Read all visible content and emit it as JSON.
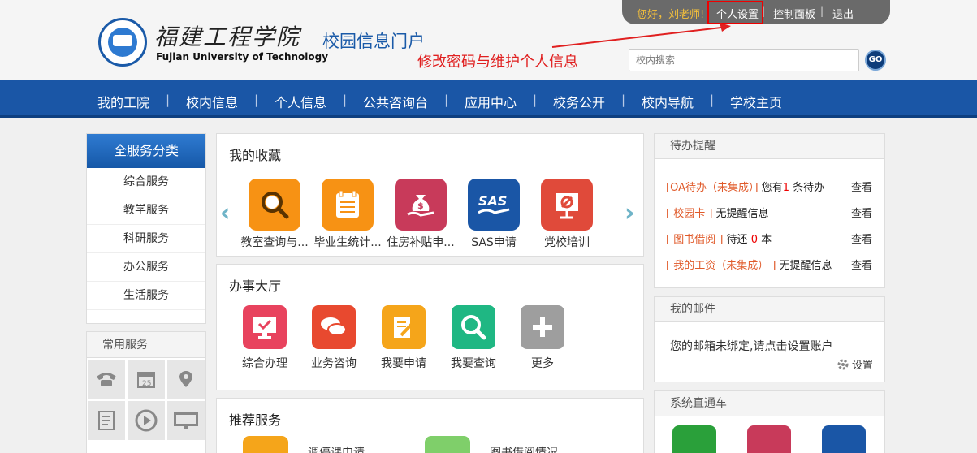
{
  "header": {
    "greeting": "您好，刘老师!",
    "links": [
      "个人设置",
      "控制面板",
      "退出"
    ],
    "separator": "|",
    "school_name_cn": "福建工程学院",
    "school_name_en": "Fujian University of Technology",
    "portal_title": "校园信息门户",
    "annotation": "修改密码与维护个人信息",
    "search_placeholder": "校内搜索",
    "go_label": "GO",
    "annotation_color": "#e02020"
  },
  "nav": {
    "items": [
      "我的工院",
      "校内信息",
      "个人信息",
      "公共咨询台",
      "应用中心",
      "校务公开",
      "校内导航",
      "学校主页"
    ],
    "separator": "|",
    "color": "#1a56a6"
  },
  "left": {
    "category_title": "全服务分类",
    "categories": [
      "综合服务",
      "教学服务",
      "科研服务",
      "办公服务",
      "生活服务"
    ],
    "common_title": "常用服务",
    "calendar_day": "25"
  },
  "favorites": {
    "title": "我的收藏",
    "items": [
      {
        "label": "教室查询与...",
        "icon": "search-icon",
        "color": "#f79214"
      },
      {
        "label": "毕业生统计...",
        "icon": "notepad-icon",
        "color": "#f79214"
      },
      {
        "label": "住房补贴申...",
        "icon": "money-bag-icon",
        "color": "#c83a5a"
      },
      {
        "label": "SAS申请",
        "icon": "sas-icon",
        "color": "#1a56a6"
      },
      {
        "label": "党校培训",
        "icon": "party-icon",
        "color": "#e04a3a"
      }
    ],
    "sas_text": "SAS",
    "money_symbol": "$"
  },
  "hall": {
    "title": "办事大厅",
    "items": [
      {
        "label": "综合办理",
        "icon": "monitor-check-icon",
        "color": "#e8435e"
      },
      {
        "label": "业务咨询",
        "icon": "chat-icon",
        "color": "#e8492f"
      },
      {
        "label": "我要申请",
        "icon": "edit-doc-icon",
        "color": "#f5a51a"
      },
      {
        "label": "我要查询",
        "icon": "search-icon",
        "color": "#1fb783"
      },
      {
        "label": "更多",
        "icon": "plus-icon",
        "color": "#9e9e9e"
      }
    ]
  },
  "recommend": {
    "title": "推荐服务",
    "items": [
      "调停课申请",
      "图书借阅情况"
    ]
  },
  "todo": {
    "title": "待办提醒",
    "view_label": "查看",
    "rows": [
      {
        "tag": "[OA待办（未集成）]",
        "pre": " 您有",
        "num": "1",
        "post": " 条待办"
      },
      {
        "tag": "[ 校园卡 ]",
        "pre": " 无提醒信息",
        "num": "",
        "post": ""
      },
      {
        "tag": "[ 图书借阅 ]",
        "pre": " 待还 ",
        "num": "0",
        "post": " 本"
      },
      {
        "tag": "[ 我的工资（未集成） ]",
        "pre": " 无提醒信息",
        "num": "",
        "post": ""
      }
    ]
  },
  "mail": {
    "title": "我的邮件",
    "message": "您的邮箱未绑定,请点击设置账户",
    "settings_label": "设置"
  },
  "direct": {
    "title": "系统直通车"
  }
}
